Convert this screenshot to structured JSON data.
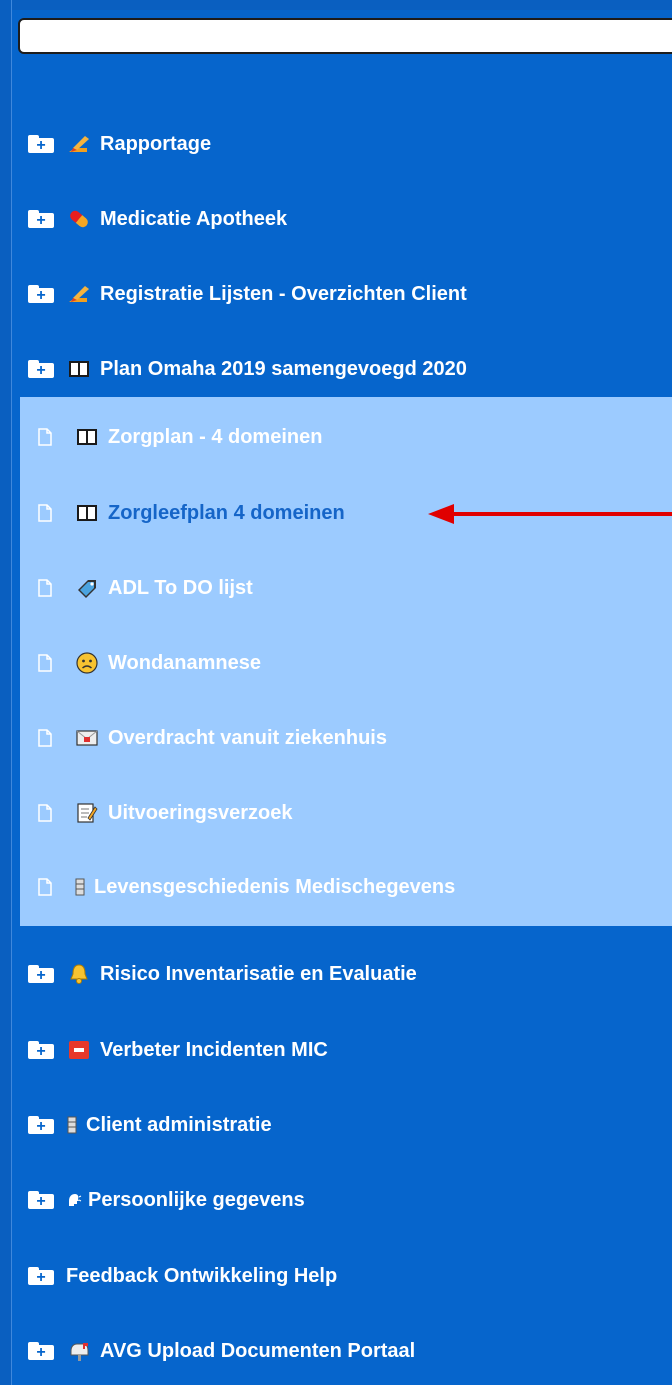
{
  "search": {
    "placeholder": "",
    "value": ""
  },
  "tree": {
    "items_top": [
      {
        "label": "Rapportage",
        "icon": "pencil-icon"
      },
      {
        "label": "Medicatie Apotheek",
        "icon": "pill-icon"
      },
      {
        "label": "Registratie Lijsten - Overzichten Client",
        "icon": "pencil-icon"
      },
      {
        "label": "Plan Omaha 2019 samengevoegd 2020",
        "icon": "book-icon"
      }
    ],
    "children": [
      {
        "label": "Zorgplan - 4 domeinen",
        "icon": "book-icon"
      },
      {
        "label": "Zorgleefplan 4 domeinen",
        "icon": "book-icon",
        "active": true
      },
      {
        "label": "ADL To DO lijst",
        "icon": "tag-icon"
      },
      {
        "label": "Wondanamnese",
        "icon": "sad-face-icon"
      },
      {
        "label": "Overdracht vanuit ziekenhuis",
        "icon": "envelope-icon"
      },
      {
        "label": "Uitvoeringsverzoek",
        "icon": "memo-icon"
      },
      {
        "label": "Levensgeschiedenis Medischegevens",
        "icon": "file-cabinet-icon"
      }
    ],
    "items_bottom": [
      {
        "label": "Risico Inventarisatie en Evaluatie",
        "icon": "bell-icon"
      },
      {
        "label": "Verbeter Incidenten MIC",
        "icon": "sos-icon"
      },
      {
        "label": "Client administratie",
        "icon": "file-cabinet-icon"
      },
      {
        "label": "Persoonlijke gegevens",
        "icon": "speaking-head-icon"
      },
      {
        "label": "Feedback Ontwikkeling Help",
        "icon": ""
      },
      {
        "label": "AVG Upload Documenten Portaal",
        "icon": "mailbox-icon"
      }
    ]
  },
  "colors": {
    "background": "#0665cc",
    "submenu_bg": "#9ccbff",
    "active_text": "#1565c8",
    "arrow": "#e00000"
  }
}
